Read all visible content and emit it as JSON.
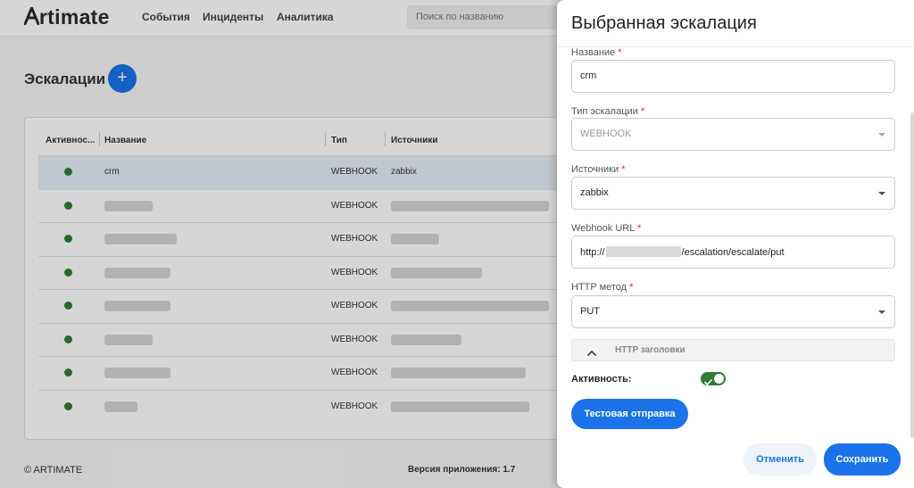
{
  "app": {
    "logo_text": "rtimate",
    "nav": [
      "События",
      "Инциденты",
      "Аналитика"
    ],
    "search_placeholder": "Поиск по названию"
  },
  "page": {
    "title": "Эскалации",
    "add_icon": "+"
  },
  "table": {
    "headers": [
      "Активнос...",
      "Название",
      "Тип",
      "Источники"
    ],
    "rows": [
      {
        "active": true,
        "name": "crm",
        "type": "WEBHOOK",
        "sources": "zabbix",
        "selected": true
      },
      {
        "active": true,
        "name": "",
        "type": "WEBHOOK",
        "sources": ""
      },
      {
        "active": true,
        "name": "",
        "type": "WEBHOOK",
        "sources": ""
      },
      {
        "active": true,
        "name": "",
        "type": "WEBHOOK",
        "sources": ""
      },
      {
        "active": true,
        "name": "",
        "type": "WEBHOOK",
        "sources": ""
      },
      {
        "active": true,
        "name": "",
        "type": "WEBHOOK",
        "sources": ""
      },
      {
        "active": true,
        "name": "",
        "type": "WEBHOOK",
        "sources": ""
      },
      {
        "active": true,
        "name": "",
        "type": "WEBHOOK",
        "sources": ""
      }
    ]
  },
  "footer": {
    "copyright": "© ARTIMATE",
    "version": "Версия приложения: 1.7"
  },
  "dialog": {
    "title": "Выбранная эскалация",
    "fields": {
      "name": {
        "label": "Название",
        "value": "crm"
      },
      "type": {
        "label": "Тип эскалации",
        "value": "WEBHOOK"
      },
      "sources": {
        "label": "Источники",
        "value": "zabbix"
      },
      "webhook_url": {
        "label": "Webhook URL",
        "prefix": "http://",
        "suffix": "/escalation/escalate/put"
      },
      "method": {
        "label": "HTTP метод",
        "value": "PUT"
      }
    },
    "required_mark": "*",
    "headers_section": "HTTP заголовки",
    "active_label": "Активность:",
    "active_value": true,
    "test_button": "Тестовая отправка",
    "cancel_button": "Отменить",
    "save_button": "Сохранить"
  },
  "colors": {
    "accent": "#1a73e8",
    "active_green": "#2e7d32",
    "required_red": "#d32f2f"
  }
}
